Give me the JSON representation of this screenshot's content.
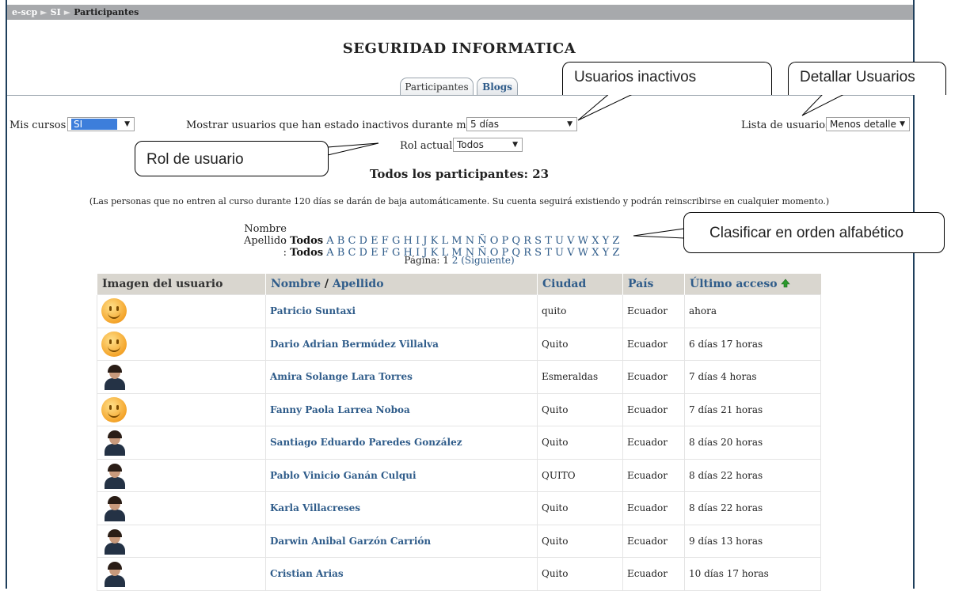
{
  "breadcrumb": {
    "site": "e-scp",
    "course": "SI",
    "current": "Participantes",
    "sep": "►"
  },
  "course_title": "SEGURIDAD INFORMATICA",
  "tabs": [
    {
      "label": "Participantes"
    },
    {
      "label": "Blogs"
    }
  ],
  "controls": {
    "my_courses_label": "Mis cursos",
    "my_courses_value": "SI",
    "inactive_label": "Mostrar usuarios que han estado inactivos durante más de",
    "inactive_value": "5 días",
    "role_label": "Rol actual:",
    "role_value": "Todos",
    "list_label": "Lista de usuarios",
    "list_value": "Menos detalle"
  },
  "callouts": {
    "inactive": "Usuarios inactivos",
    "detail": "Detallar Usuarios",
    "role": "Rol de usuario",
    "alpha": "Clasificar en orden alfabético"
  },
  "total": "Todos los participantes: 23",
  "note": "(Las personas que no entren al curso durante 120 días se darán de baja automáticamente. Su cuenta seguirá existiendo y podrán reinscribirse en cualquier momento.)",
  "alpha": {
    "first_label": "Nombre :",
    "last_label": "Apellido :",
    "all": "Todos",
    "letters": [
      "A",
      "B",
      "C",
      "D",
      "E",
      "F",
      "G",
      "H",
      "I",
      "J",
      "K",
      "L",
      "M",
      "N",
      "Ñ",
      "O",
      "P",
      "Q",
      "R",
      "S",
      "T",
      "U",
      "V",
      "W",
      "X",
      "Y",
      "Z"
    ]
  },
  "paging": {
    "label": "Página:",
    "current": "1",
    "next_page": "2",
    "next_label": "(Siguiente)"
  },
  "table": {
    "headers": {
      "image": "Imagen del usuario",
      "first": "Nombre",
      "slash": " / ",
      "last": "Apellido",
      "city": "Ciudad",
      "country": "País",
      "access": "Último acceso"
    },
    "rows": [
      {
        "avatar": "smiley",
        "name": "Patricio Suntaxi",
        "city": "quito",
        "country": "Ecuador",
        "access": "ahora"
      },
      {
        "avatar": "smiley",
        "name": "Dario Adrian Bermúdez Villalva",
        "city": "Quito",
        "country": "Ecuador",
        "access": "6 días 17 horas"
      },
      {
        "avatar": "photo",
        "name": "Amira Solange Lara Torres",
        "city": "Esmeraldas",
        "country": "Ecuador",
        "access": "7 días 4 horas"
      },
      {
        "avatar": "smiley",
        "name": "Fanny Paola Larrea Noboa",
        "city": "Quito",
        "country": "Ecuador",
        "access": "7 días 21 horas"
      },
      {
        "avatar": "photo",
        "name": "Santiago Eduardo Paredes González",
        "city": "Quito",
        "country": "Ecuador",
        "access": "8 días 20 horas"
      },
      {
        "avatar": "photo",
        "name": "Pablo Vinicio Ganán Culqui",
        "city": "QUITO",
        "country": "Ecuador",
        "access": "8 días 22 horas"
      },
      {
        "avatar": "photo",
        "name": "Karla Villacreses",
        "city": "Quito",
        "country": "Ecuador",
        "access": "8 días 22 horas"
      },
      {
        "avatar": "photo",
        "name": "Darwin Anibal Garzón Carrión",
        "city": "Quito",
        "country": "Ecuador",
        "access": "9 días 13 horas"
      },
      {
        "avatar": "photo",
        "name": "Cristian Arias",
        "city": "Quito",
        "country": "Ecuador",
        "access": "10 días 17 horas"
      }
    ]
  }
}
